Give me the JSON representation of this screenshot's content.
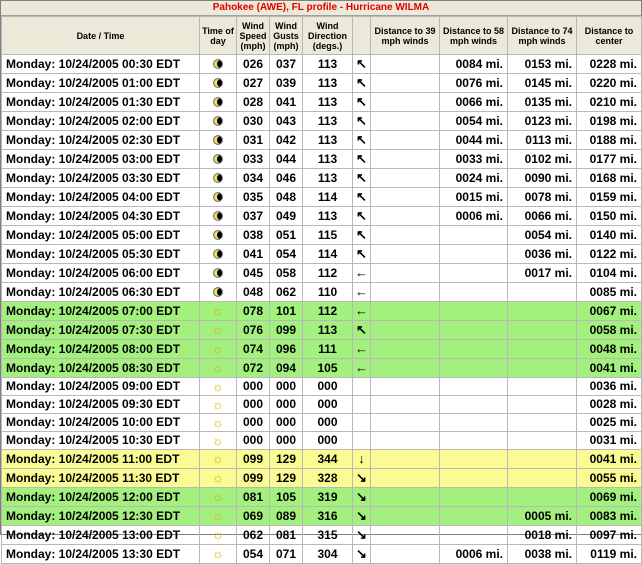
{
  "title": "Pahokee (AWE), FL profile - Hurricane WILMA",
  "headers": {
    "date": "Date / Time",
    "tod": "Time of day",
    "speed": "Wind Speed (mph)",
    "gusts": "Wind Gusts (mph)",
    "dir": "Wind Direction (degs.)",
    "d39": "Distance to 39 mph winds",
    "d58": "Distance to 58 mph winds",
    "d74": "Distance to 74 mph winds",
    "dc": "Distance to center"
  },
  "colors": {
    "green": "#a3f07e",
    "yellow": "#fbfb94",
    "title": "#e00000"
  },
  "rows": [
    {
      "date": "Monday: 10/24/2005 00:30 EDT",
      "tod": "night",
      "speed": "026",
      "gusts": "037",
      "dir": "113",
      "arrow": "↖",
      "d39": "",
      "d58": "0084 mi.",
      "d74": "0153 mi.",
      "dc": "0228 mi.",
      "hl": ""
    },
    {
      "date": "Monday: 10/24/2005 01:00 EDT",
      "tod": "night",
      "speed": "027",
      "gusts": "039",
      "dir": "113",
      "arrow": "↖",
      "d39": "",
      "d58": "0076 mi.",
      "d74": "0145 mi.",
      "dc": "0220 mi.",
      "hl": ""
    },
    {
      "date": "Monday: 10/24/2005 01:30 EDT",
      "tod": "night",
      "speed": "028",
      "gusts": "041",
      "dir": "113",
      "arrow": "↖",
      "d39": "",
      "d58": "0066 mi.",
      "d74": "0135 mi.",
      "dc": "0210 mi.",
      "hl": ""
    },
    {
      "date": "Monday: 10/24/2005 02:00 EDT",
      "tod": "night",
      "speed": "030",
      "gusts": "043",
      "dir": "113",
      "arrow": "↖",
      "d39": "",
      "d58": "0054 mi.",
      "d74": "0123 mi.",
      "dc": "0198 mi.",
      "hl": ""
    },
    {
      "date": "Monday: 10/24/2005 02:30 EDT",
      "tod": "night",
      "speed": "031",
      "gusts": "042",
      "dir": "113",
      "arrow": "↖",
      "d39": "",
      "d58": "0044 mi.",
      "d74": "0113 mi.",
      "dc": "0188 mi.",
      "hl": ""
    },
    {
      "date": "Monday: 10/24/2005 03:00 EDT",
      "tod": "night",
      "speed": "033",
      "gusts": "044",
      "dir": "113",
      "arrow": "↖",
      "d39": "",
      "d58": "0033 mi.",
      "d74": "0102 mi.",
      "dc": "0177 mi.",
      "hl": ""
    },
    {
      "date": "Monday: 10/24/2005 03:30 EDT",
      "tod": "night",
      "speed": "034",
      "gusts": "046",
      "dir": "113",
      "arrow": "↖",
      "d39": "",
      "d58": "0024 mi.",
      "d74": "0090 mi.",
      "dc": "0168 mi.",
      "hl": ""
    },
    {
      "date": "Monday: 10/24/2005 04:00 EDT",
      "tod": "night",
      "speed": "035",
      "gusts": "048",
      "dir": "114",
      "arrow": "↖",
      "d39": "",
      "d58": "0015 mi.",
      "d74": "0078 mi.",
      "dc": "0159 mi.",
      "hl": ""
    },
    {
      "date": "Monday: 10/24/2005 04:30 EDT",
      "tod": "night",
      "speed": "037",
      "gusts": "049",
      "dir": "113",
      "arrow": "↖",
      "d39": "",
      "d58": "0006 mi.",
      "d74": "0066 mi.",
      "dc": "0150 mi.",
      "hl": ""
    },
    {
      "date": "Monday: 10/24/2005 05:00 EDT",
      "tod": "night",
      "speed": "038",
      "gusts": "051",
      "dir": "115",
      "arrow": "↖",
      "d39": "",
      "d58": "",
      "d74": "0054 mi.",
      "dc": "0140 mi.",
      "hl": ""
    },
    {
      "date": "Monday: 10/24/2005 05:30 EDT",
      "tod": "night",
      "speed": "041",
      "gusts": "054",
      "dir": "114",
      "arrow": "↖",
      "d39": "",
      "d58": "",
      "d74": "0036 mi.",
      "dc": "0122 mi.",
      "hl": ""
    },
    {
      "date": "Monday: 10/24/2005 06:00 EDT",
      "tod": "night",
      "speed": "045",
      "gusts": "058",
      "dir": "112",
      "arrow": "←",
      "d39": "",
      "d58": "",
      "d74": "0017 mi.",
      "dc": "0104 mi.",
      "hl": ""
    },
    {
      "date": "Monday: 10/24/2005 06:30 EDT",
      "tod": "night",
      "speed": "048",
      "gusts": "062",
      "dir": "110",
      "arrow": "←",
      "d39": "",
      "d58": "",
      "d74": "",
      "dc": "0085 mi.",
      "hl": ""
    },
    {
      "date": "Monday: 10/24/2005 07:00 EDT",
      "tod": "day",
      "speed": "078",
      "gusts": "101",
      "dir": "112",
      "arrow": "←",
      "d39": "",
      "d58": "",
      "d74": "",
      "dc": "0067 mi.",
      "hl": "green"
    },
    {
      "date": "Monday: 10/24/2005 07:30 EDT",
      "tod": "day",
      "speed": "076",
      "gusts": "099",
      "dir": "113",
      "arrow": "↖",
      "d39": "",
      "d58": "",
      "d74": "",
      "dc": "0058 mi.",
      "hl": "green"
    },
    {
      "date": "Monday: 10/24/2005 08:00 EDT",
      "tod": "day",
      "speed": "074",
      "gusts": "096",
      "dir": "111",
      "arrow": "←",
      "d39": "",
      "d58": "",
      "d74": "",
      "dc": "0048 mi.",
      "hl": "green"
    },
    {
      "date": "Monday: 10/24/2005 08:30 EDT",
      "tod": "day",
      "speed": "072",
      "gusts": "094",
      "dir": "105",
      "arrow": "←",
      "d39": "",
      "d58": "",
      "d74": "",
      "dc": "0041 mi.",
      "hl": "green"
    },
    {
      "date": "Monday: 10/24/2005 09:00 EDT",
      "tod": "day",
      "speed": "000",
      "gusts": "000",
      "dir": "000",
      "arrow": "",
      "d39": "",
      "d58": "",
      "d74": "",
      "dc": "0036 mi.",
      "hl": ""
    },
    {
      "date": "Monday: 10/24/2005 09:30 EDT",
      "tod": "day",
      "speed": "000",
      "gusts": "000",
      "dir": "000",
      "arrow": "",
      "d39": "",
      "d58": "",
      "d74": "",
      "dc": "0028 mi.",
      "hl": ""
    },
    {
      "date": "Monday: 10/24/2005 10:00 EDT",
      "tod": "day",
      "speed": "000",
      "gusts": "000",
      "dir": "000",
      "arrow": "",
      "d39": "",
      "d58": "",
      "d74": "",
      "dc": "0025 mi.",
      "hl": ""
    },
    {
      "date": "Monday: 10/24/2005 10:30 EDT",
      "tod": "day",
      "speed": "000",
      "gusts": "000",
      "dir": "000",
      "arrow": "",
      "d39": "",
      "d58": "",
      "d74": "",
      "dc": "0031 mi.",
      "hl": ""
    },
    {
      "date": "Monday: 10/24/2005 11:00 EDT",
      "tod": "day",
      "speed": "099",
      "gusts": "129",
      "dir": "344",
      "arrow": "↓",
      "d39": "",
      "d58": "",
      "d74": "",
      "dc": "0041 mi.",
      "hl": "yellow"
    },
    {
      "date": "Monday: 10/24/2005 11:30 EDT",
      "tod": "day",
      "speed": "099",
      "gusts": "129",
      "dir": "328",
      "arrow": "↘",
      "d39": "",
      "d58": "",
      "d74": "",
      "dc": "0055 mi.",
      "hl": "yellow"
    },
    {
      "date": "Monday: 10/24/2005 12:00 EDT",
      "tod": "day",
      "speed": "081",
      "gusts": "105",
      "dir": "319",
      "arrow": "↘",
      "d39": "",
      "d58": "",
      "d74": "",
      "dc": "0069 mi.",
      "hl": "green"
    },
    {
      "date": "Monday: 10/24/2005 12:30 EDT",
      "tod": "day",
      "speed": "069",
      "gusts": "089",
      "dir": "316",
      "arrow": "↘",
      "d39": "",
      "d58": "",
      "d74": "0005 mi.",
      "dc": "0083 mi.",
      "hl": "green"
    },
    {
      "date": "Monday: 10/24/2005 13:00 EDT",
      "tod": "day",
      "speed": "062",
      "gusts": "081",
      "dir": "315",
      "arrow": "↘",
      "d39": "",
      "d58": "",
      "d74": "0018 mi.",
      "dc": "0097 mi.",
      "hl": ""
    },
    {
      "date": "Monday: 10/24/2005 13:30 EDT",
      "tod": "day",
      "speed": "054",
      "gusts": "071",
      "dir": "304",
      "arrow": "↘",
      "d39": "",
      "d58": "0006 mi.",
      "d74": "0038 mi.",
      "dc": "0119 mi.",
      "hl": ""
    }
  ]
}
